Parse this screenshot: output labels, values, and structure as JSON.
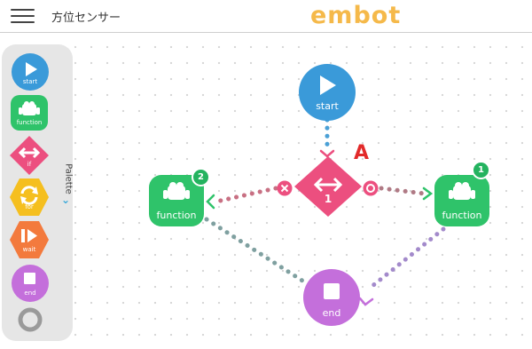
{
  "header": {
    "title": "方位センサー",
    "logo": "embot",
    "menu_icon": "hamburger-menu-icon"
  },
  "palette": {
    "label": "Palette",
    "collapse_icon": "chevron-down-icon",
    "items": [
      {
        "label": "start",
        "icon": "play-icon",
        "color": "#3a9ad9"
      },
      {
        "label": "function",
        "icon": "robot-icon",
        "color": "#2fc36a"
      },
      {
        "label": "if",
        "icon": "left-right-arrows-icon",
        "color": "#ec4f7f"
      },
      {
        "label": "for",
        "icon": "loop-icon",
        "color": "#f5bf1f"
      },
      {
        "label": "wait",
        "icon": "pause-play-icon",
        "color": "#f37a3d"
      },
      {
        "label": "end",
        "icon": "stop-icon",
        "color": "#c46fdb"
      },
      {
        "label": "",
        "icon": "ring-icon",
        "color": "#9a9a9a"
      }
    ]
  },
  "flow": {
    "start": {
      "label": "start",
      "color": "#3a9ad9"
    },
    "if": {
      "label": "1",
      "color": "#ec4f7f",
      "false_icon": "cross-icon",
      "true_icon": "circle-icon"
    },
    "function_left": {
      "label": "function",
      "badge": "2",
      "color": "#2fc36a"
    },
    "function_right": {
      "label": "function",
      "badge": "1",
      "color": "#2fc36a"
    },
    "end": {
      "label": "end",
      "color": "#c46fdb"
    },
    "annotation": "A"
  }
}
